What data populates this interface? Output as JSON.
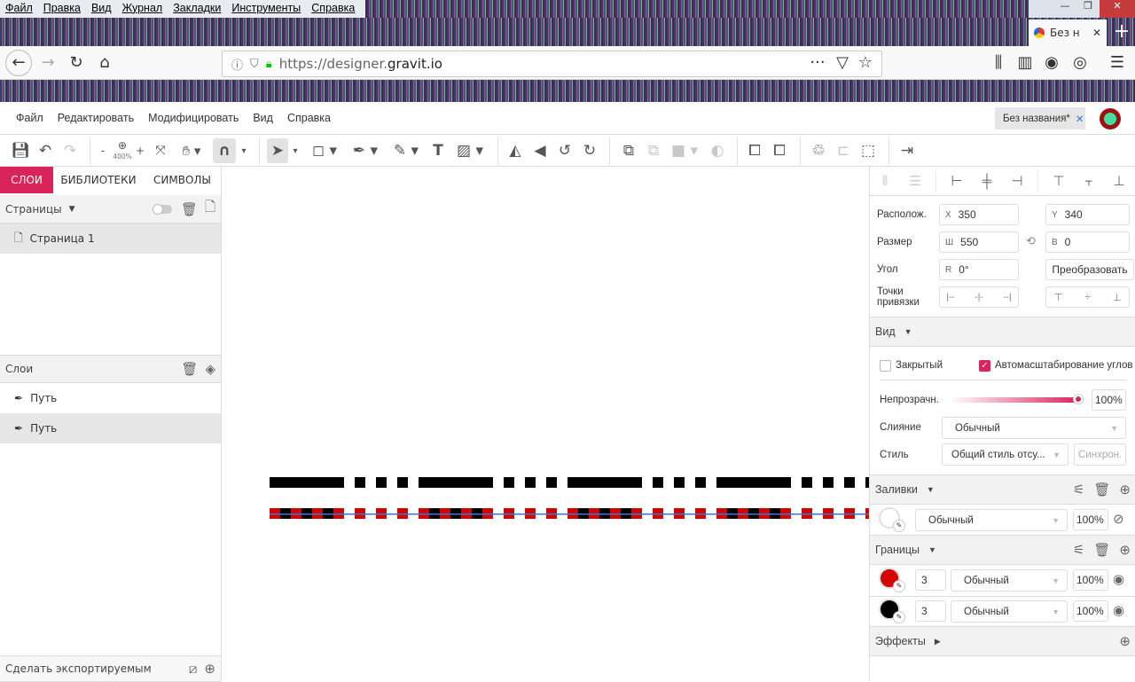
{
  "os_menu": [
    "Файл",
    "Правка",
    "Вид",
    "Журнал",
    "Закладки",
    "Инструменты",
    "Справка"
  ],
  "browser": {
    "active_tab": "Без н",
    "url_scheme": "https://designer.",
    "url_host": "gravit.io",
    "new_tab": "+",
    "close": "✕"
  },
  "app_menu": [
    "Файл",
    "Редактировать",
    "Модифицировать",
    "Вид",
    "Справка"
  ],
  "document_tab": {
    "title": "Без названия*",
    "close": "✕"
  },
  "toolbar": {
    "zoom_level": "400%",
    "zoom_out": "-",
    "zoom_in": "+"
  },
  "left": {
    "tabs": [
      "СЛОИ",
      "БИБЛИОТЕКИ",
      "СИМВОЛЫ"
    ],
    "pages_header": "Страницы",
    "pages": [
      "Страница 1"
    ],
    "layers_header": "Слои",
    "layers": [
      "Путь",
      "Путь"
    ],
    "export_label": "Сделать экспортируемым"
  },
  "canvas": {
    "colors": {
      "top_stroke": "#000000",
      "stroke_red": "#d40000",
      "stroke_black": "#000000",
      "selection": "#2b7cd3"
    }
  },
  "right": {
    "position_label": "Располож.",
    "x_key": "X",
    "x": "350",
    "y_key": "Y",
    "y": "340",
    "size_label": "Размер",
    "w_key": "Ш",
    "w": "550",
    "h_key": "В",
    "h": "0",
    "angle_label": "Угол",
    "r_key": "R",
    "angle": "0°",
    "transform_button": "Преобразовать",
    "anchor_label": "Точки привязки",
    "view_header": "Вид",
    "closed_label": "Закрытый",
    "closed_checked": false,
    "auto_scale_label": "Автомасштабирование углов",
    "auto_scale_checked": true,
    "opacity_label": "Непрозрачн.",
    "opacity": "100%",
    "opacity_value": 100,
    "blend_label": "Слияние",
    "blend": "Обычный",
    "style_label": "Стиль",
    "style": "Общий стиль отсу...",
    "sync_button": "Синхрон.",
    "fills_header": "Заливки",
    "fills": [
      {
        "mode": "Обычный",
        "opacity": "100%",
        "color": "#ffffff",
        "visible": false
      }
    ],
    "borders_header": "Границы",
    "borders": [
      {
        "width": "3",
        "mode": "Обычный",
        "opacity": "100%",
        "color": "#d40000"
      },
      {
        "width": "3",
        "mode": "Обычный",
        "opacity": "100%",
        "color": "#000000"
      }
    ],
    "effects_header": "Эффекты"
  },
  "accent": "#d9245b"
}
